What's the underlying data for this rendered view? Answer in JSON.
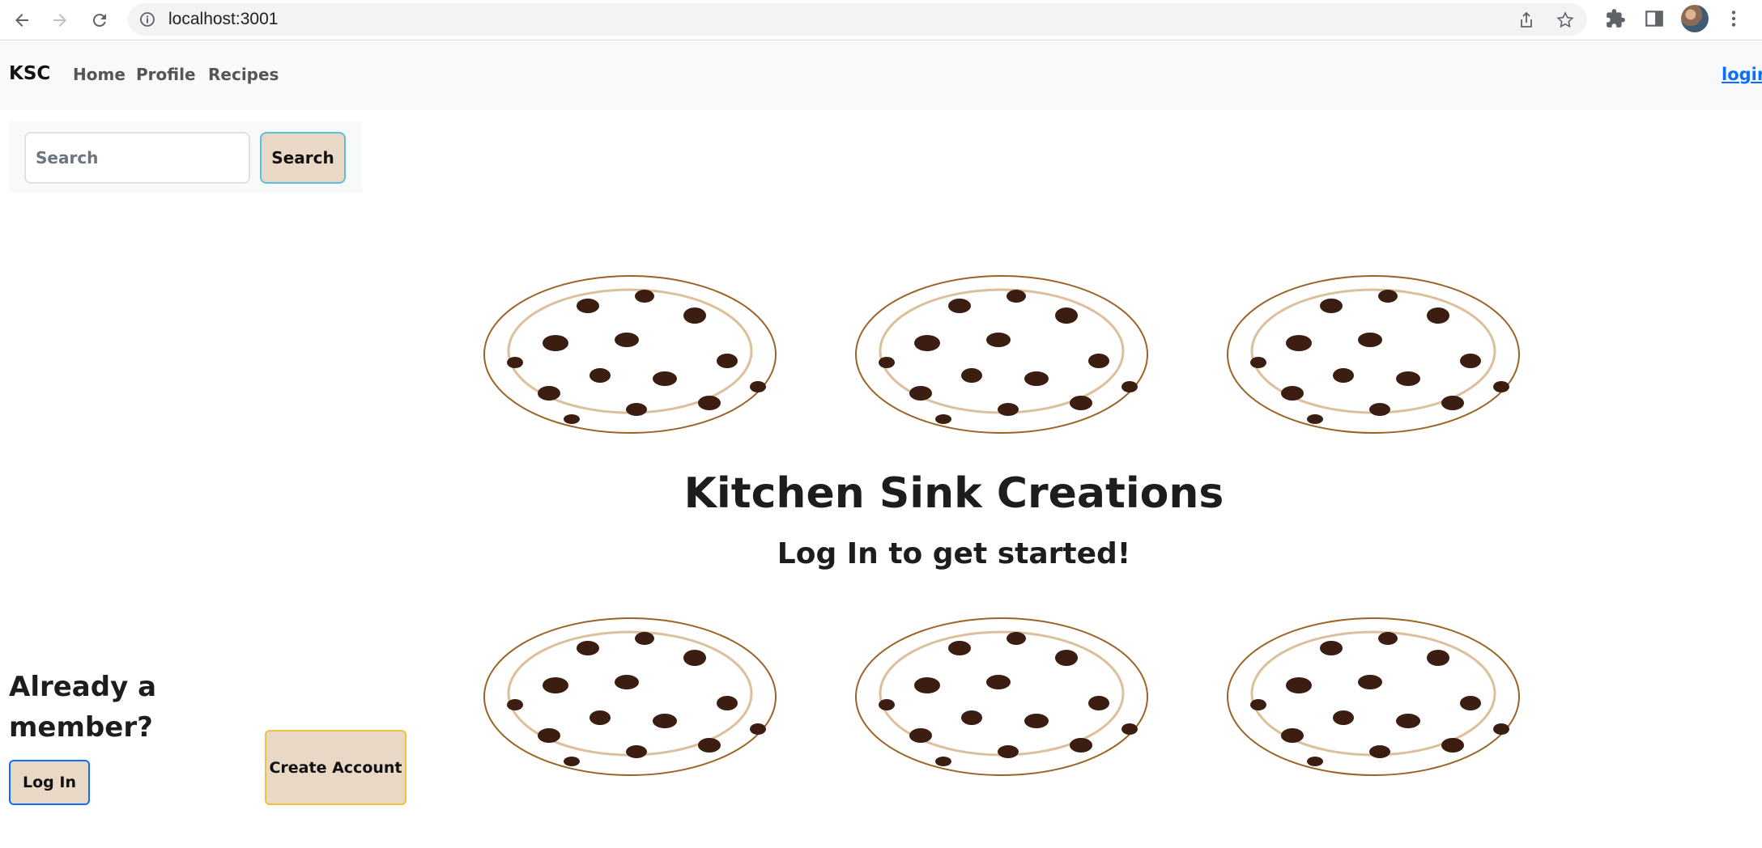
{
  "browser": {
    "url": "localhost:3001",
    "icons": [
      "back-icon",
      "forward-icon",
      "reload-icon",
      "site-info-icon",
      "share-icon",
      "bookmark-star-icon",
      "extensions-icon",
      "side-panel-icon",
      "profile-avatar",
      "menu-kebab-icon"
    ]
  },
  "navbar": {
    "brand": "KSC",
    "links": [
      "Home",
      "Profile",
      "Recipes"
    ],
    "login": "login"
  },
  "search": {
    "placeholder": "Search",
    "button": "Search"
  },
  "hero": {
    "title": "Kitchen Sink Creations",
    "subtitle": "Log In to get started!"
  },
  "member": {
    "question": "Already a member?",
    "login_button": "Log In",
    "create_button": "Create Account"
  },
  "colors": {
    "button_bg": "#ead8c7",
    "link": "#0d6efd",
    "navbar_bg": "#f8f9fa",
    "cookie": "#d4a04e"
  }
}
